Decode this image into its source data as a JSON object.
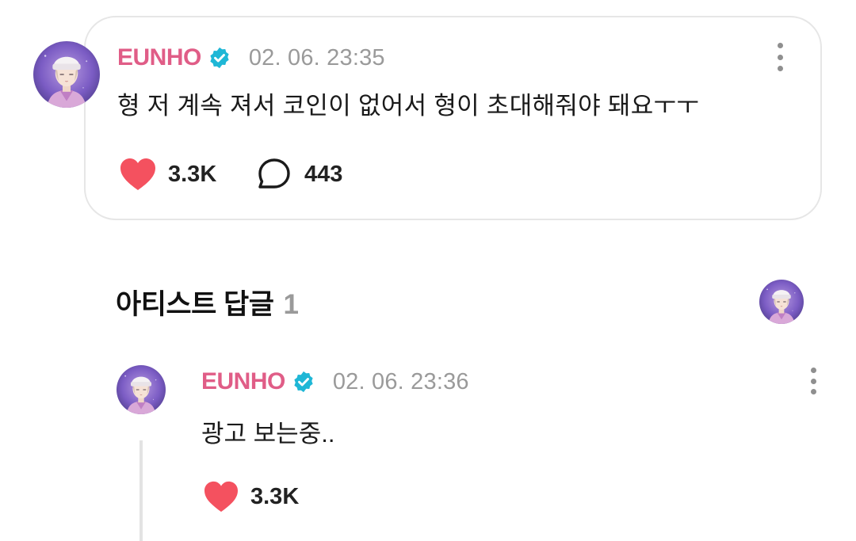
{
  "post": {
    "author": "EUNHO",
    "timestamp": "02. 06. 23:35",
    "text": "형 저 계속 져서 코인이 없어서 형이 초대해줘야 돼요ㅜㅜ",
    "likes": "3.3K",
    "comments": "443",
    "icons": {
      "avatar": "avatar-icon",
      "verified": "verified-badge-icon",
      "more": "more-vertical-icon",
      "like": "heart-icon",
      "comment": "comment-bubble-icon"
    }
  },
  "replies_section": {
    "title": "아티스트 답글",
    "count": "1"
  },
  "reply": {
    "author": "EUNHO",
    "timestamp": "02. 06. 23:36",
    "text": "광고 보는중..",
    "likes": "3.3K"
  },
  "colors": {
    "author": "#e05d87",
    "verified": "#1fb7d6",
    "heart": "#f4515f",
    "muted": "#9a9a9a"
  }
}
